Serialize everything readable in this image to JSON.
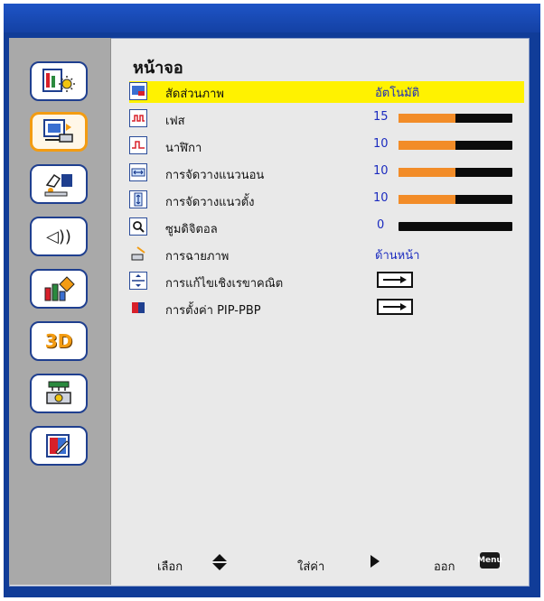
{
  "menu": {
    "title": "หน้าจอ",
    "items": [
      {
        "label": "สัดส่วนภาพ",
        "value": "อัตโนมัติ"
      },
      {
        "label": "เฟส",
        "value": "15"
      },
      {
        "label": "นาฬิกา",
        "value": "10"
      },
      {
        "label": "การจัดวางแนวนอน",
        "value": "10"
      },
      {
        "label": "การจัดวางแนวตั้ง",
        "value": "10"
      },
      {
        "label": "ซูมดิจิตอล",
        "value": "0"
      },
      {
        "label": "การฉายภาพ",
        "value": "ด้านหน้า"
      },
      {
        "label": "การแก้ไขเชิงเรขาคณิต"
      },
      {
        "label": "การตั้งค่า PIP-PBP"
      }
    ],
    "levels": {
      "phase": 0.5,
      "clock": 0.5,
      "h_position": 0.5,
      "v_position": 0.5,
      "digital_zoom": 0.0
    }
  },
  "footer": {
    "select_label": "เลือก",
    "enter_label": "ใส่ค่า",
    "exit_label": "ออก",
    "menu_key": "Menu"
  },
  "colors": {
    "highlight": "#fff200",
    "slider_fill": "#f28c28",
    "value_text": "#1b2bbf"
  }
}
